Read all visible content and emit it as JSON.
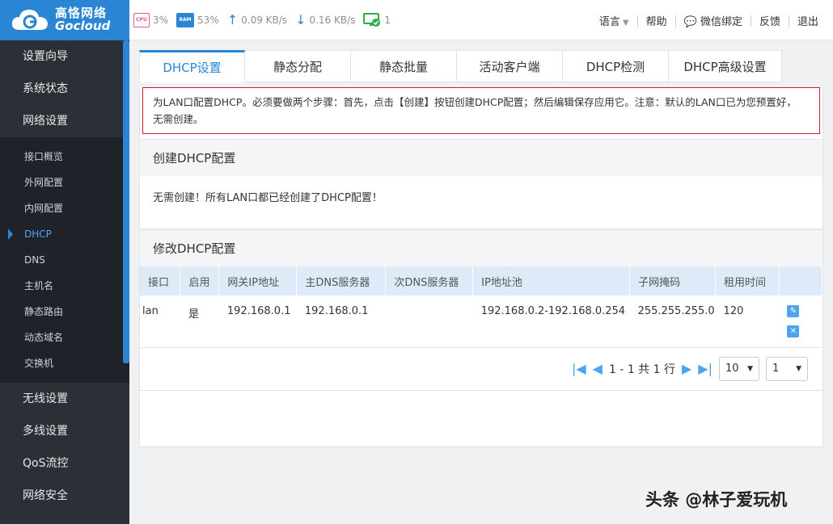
{
  "brand": {
    "cn": "高恪网络",
    "en": "Gocloud"
  },
  "stats": {
    "cpu_label": "CPU",
    "cpu": "3%",
    "ram_label": "RAM",
    "ram": "53%",
    "upload": "0.09 KB/s",
    "download": "0.16 KB/s",
    "devices": "1"
  },
  "topmenu": [
    "语言",
    "帮助",
    "微信绑定",
    "反馈",
    "退出"
  ],
  "sidebar": {
    "groups_top": [
      "设置向导",
      "系统状态",
      "网络设置"
    ],
    "sub_items": [
      "接口概览",
      "外网配置",
      "内网配置",
      "DHCP",
      "DNS",
      "主机名",
      "静态路由",
      "动态域名",
      "交换机"
    ],
    "groups_bottom": [
      "无线设置",
      "多线设置",
      "QoS流控",
      "网络安全"
    ]
  },
  "tabs": [
    "DHCP设置",
    "静态分配",
    "静态批量",
    "活动客户端",
    "DHCP检测",
    "DHCP高级设置"
  ],
  "notice": "为LAN口配置DHCP。必须要做两个步骤：首先，点击【创建】按钮创建DHCP配置；然后编辑保存应用它。注意：默认的LAN口已为您预置好， 无需创建。",
  "create": {
    "title": "创建DHCP配置",
    "message": "无需创建！所有LAN口都已经创建了DHCP配置！"
  },
  "modify": {
    "title": "修改DHCP配置",
    "headers": [
      "接口",
      "启用",
      "网关IP地址",
      "主DNS服务器",
      "次DNS服务器",
      "IP地址池",
      "子网掩码",
      "租用时间"
    ],
    "row": {
      "iface": "lan",
      "enabled": "是",
      "gateway": "192.168.0.1",
      "dns1": "192.168.0.1",
      "dns2": "",
      "pool": "192.168.0.2-192.168.0.254",
      "mask": "255.255.255.0",
      "lease": "120"
    }
  },
  "pager": {
    "info": "1 - 1 共 1 行",
    "page_size": "10",
    "page": "1"
  },
  "watermark": "头条 @林子爱玩机"
}
